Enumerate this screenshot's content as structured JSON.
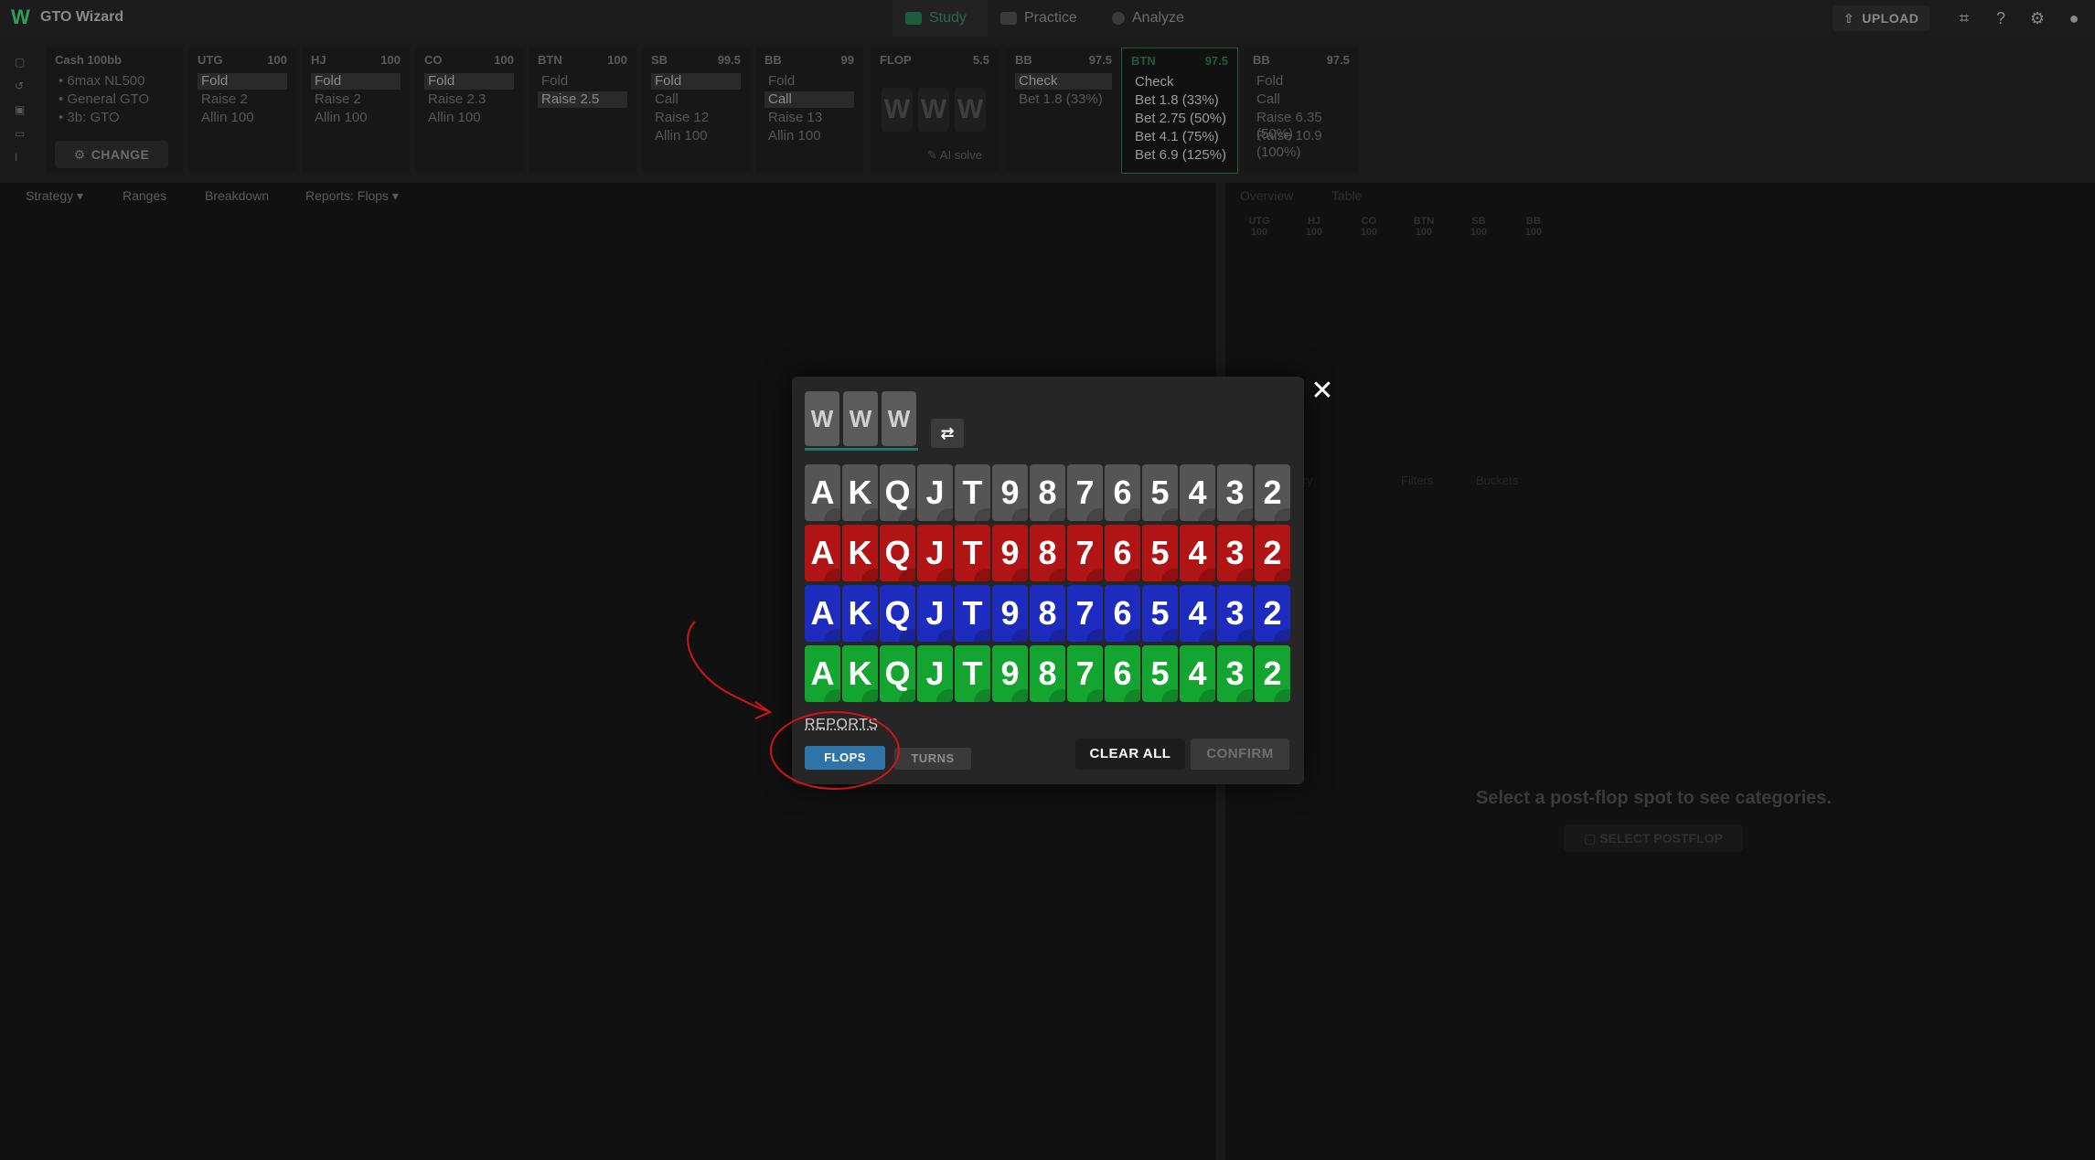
{
  "app": {
    "title": "GTO Wizard"
  },
  "nav": {
    "tabs": [
      "Study",
      "Practice",
      "Analyze"
    ],
    "active": "Study"
  },
  "topbar": {
    "upload_label": "UPLOAD"
  },
  "config": {
    "title": "Cash 100bb",
    "lines": [
      "6max NL500",
      "General GTO",
      "3b: GTO"
    ],
    "change_label": "CHANGE"
  },
  "positions": [
    {
      "name": "UTG",
      "stack": "100",
      "rows": [
        "Fold",
        "Raise 2",
        "Allin 100"
      ]
    },
    {
      "name": "HJ",
      "stack": "100",
      "rows": [
        "Fold",
        "Raise 2",
        "Allin 100"
      ]
    },
    {
      "name": "CO",
      "stack": "100",
      "rows": [
        "Fold",
        "Raise 2.3",
        "Allin 100"
      ]
    },
    {
      "name": "BTN",
      "stack": "100",
      "rows": [
        "Fold",
        "Raise 2.5"
      ]
    },
    {
      "name": "SB",
      "stack": "99.5",
      "rows": [
        "Fold",
        "Call",
        "Raise 12",
        "Allin 100"
      ]
    },
    {
      "name": "BB",
      "stack": "99",
      "rows": [
        "Fold",
        "Call",
        "Raise 13",
        "Allin 100"
      ]
    }
  ],
  "flop": {
    "name": "FLOP",
    "pot": "5.5",
    "ai_label": "AI solve",
    "cards": [
      "W",
      "W",
      "W"
    ]
  },
  "postflop": [
    {
      "name": "BB",
      "stack": "97.5",
      "rows": [
        "Check",
        "Bet 1.8 (33%)"
      ]
    },
    {
      "name": "BTN",
      "stack": "97.5",
      "rows": [
        "Check",
        "Bet 1.8 (33%)",
        "Bet 2.75 (50%)",
        "Bet 4.1 (75%)",
        "Bet 6.9 (125%)"
      ]
    },
    {
      "name": "BB",
      "stack": "97.5",
      "rows": [
        "Fold",
        "Call",
        "Raise 6.35 (50%)",
        "Raise 10.9 (100%)"
      ]
    }
  ],
  "subtabs": [
    "Strategy",
    "Ranges",
    "Breakdown",
    "Reports: Flops"
  ],
  "right": {
    "tabs": [
      "Overview",
      "Table"
    ],
    "players": [
      "UTG",
      "HJ",
      "CO",
      "BTN",
      "SB",
      "BB"
    ],
    "player_stack": "100",
    "lower_tabs": [
      "Summary",
      "Filters",
      "Buckets"
    ],
    "placeholder": "Select a post-flop spot to see categories.",
    "select_label": "SELECT POSTFLOP"
  },
  "modal": {
    "board": [
      "W",
      "W",
      "W"
    ],
    "ranks": [
      "A",
      "K",
      "Q",
      "J",
      "T",
      "9",
      "8",
      "7",
      "6",
      "5",
      "4",
      "3",
      "2"
    ],
    "suit_colors": [
      "#555555",
      "#b01414",
      "#1e2bbf",
      "#13a530"
    ],
    "reports_label": "REPORTS",
    "flops_label": "FLOPS",
    "turns_label": "TURNS",
    "clear_label": "CLEAR ALL",
    "confirm_label": "CONFIRM"
  }
}
